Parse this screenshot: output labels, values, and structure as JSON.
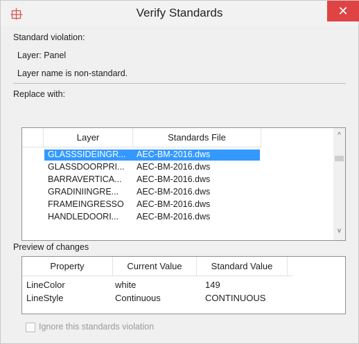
{
  "window": {
    "title": "Verify Standards",
    "close_glyph": "✕",
    "app_icon": "standards-app-icon"
  },
  "violation": {
    "heading": "Standard violation:",
    "layer_line": "Layer:  Panel",
    "message": "Layer name is non-standard."
  },
  "replace": {
    "heading": "Replace with:",
    "columns": [
      "Layer",
      "Standards File"
    ],
    "rows": [
      {
        "layer": "GLASSSIDEINGR...",
        "file": "AEC-BM-2016.dws",
        "selected": true
      },
      {
        "layer": "GLASSDOORPRI...",
        "file": "AEC-BM-2016.dws",
        "selected": false
      },
      {
        "layer": "BARRAVERTICA...",
        "file": "AEC-BM-2016.dws",
        "selected": false
      },
      {
        "layer": "GRADINIINGRE...",
        "file": "AEC-BM-2016.dws",
        "selected": false
      },
      {
        "layer": "FRAMEINGRESSO",
        "file": "AEC-BM-2016.dws",
        "selected": false
      },
      {
        "layer": "HANDLEDOORI...",
        "file": "AEC-BM-2016.dws",
        "selected": false
      }
    ],
    "scroll_up": "^",
    "scroll_down": "v"
  },
  "preview": {
    "heading": "Preview of changes",
    "columns": [
      "Property",
      "Current Value",
      "Standard Value"
    ],
    "rows": [
      {
        "property": "LineColor",
        "current": "white",
        "standard": "149"
      },
      {
        "property": "LineStyle",
        "current": "Continuous",
        "standard": "CONTINUOUS"
      }
    ]
  },
  "ignore": {
    "label": "Ignore this standards violation",
    "checked": false
  },
  "colors": {
    "selection": "#3399ff",
    "close": "#e04343"
  }
}
